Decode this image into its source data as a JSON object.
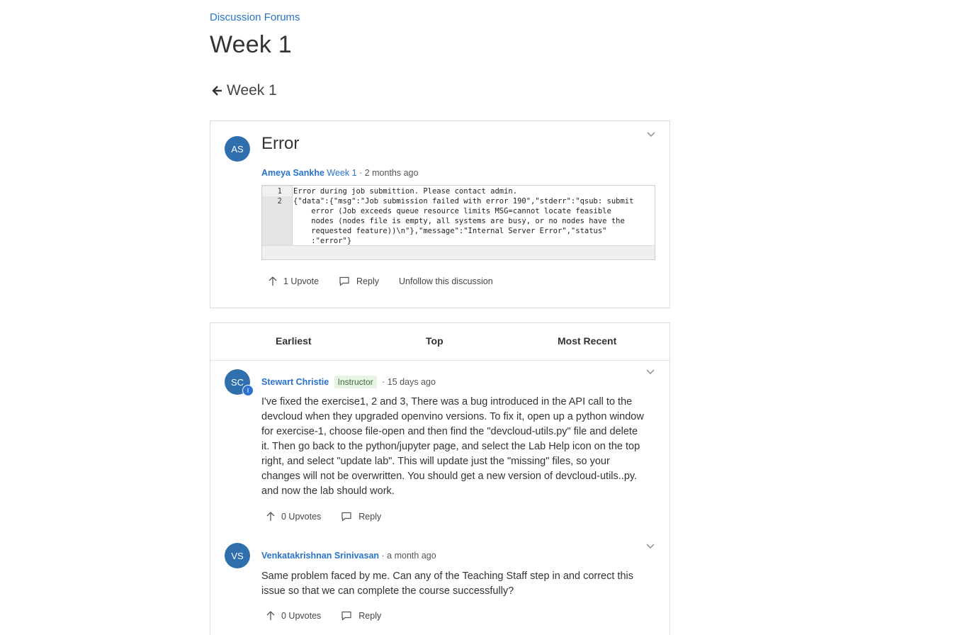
{
  "breadcrumb": "Discussion Forums",
  "page_title": "Week 1",
  "back_link": "Week 1",
  "thread": {
    "avatar_initials": "AS",
    "title": "Error",
    "author": "Ameya Sankhe",
    "topic": "Week 1",
    "time": "· 2 months ago",
    "code_line_numbers": [
      "1",
      "2"
    ],
    "code_text": "Error during job submittion. Please contact admin.\n{\"data\":{\"msg\":\"Job submission failed with error 190\",\"stderr\":\"qsub: submit\n    error (Job exceeds queue resource limits MSG=cannot locate feasible\n    nodes (nodes file is empty, all systems are busy, or no nodes have the\n    requested feature))\\n\"},\"message\":\"Internal Server Error\",\"status\"\n    :\"error\"}",
    "upvote_label": "1 Upvote",
    "reply_label": "Reply",
    "unfollow_label": "Unfollow this discussion"
  },
  "sort_tabs": [
    "Earliest",
    "Top",
    "Most Recent"
  ],
  "responses": [
    {
      "avatar_initials": "SC",
      "role_dot": "I",
      "author": "Stewart Christie",
      "badge": "Instructor",
      "time": "· 15 days ago",
      "body": "I've fixed the exercise1, 2 and 3, There was a bug introduced in the API call to the devcloud when they upgraded openvino versions. To fix it, open up a python window for exercise-1, choose file-open and then find the \"devcloud-utils.py\" file and delete it. Then go back to the python/jupyter page, and select the Lab Help icon on the top right, and select \"update lab\". This will update just the \"missing\" files, so your changes will not be overwritten. You should get a new version of devcloud-utils..py. and now the lab should work.",
      "upvote_label": "0 Upvotes",
      "reply_label": "Reply"
    },
    {
      "avatar_initials": "VS",
      "author": "Venkatakrishnan Srinivasan",
      "time": "· a month ago",
      "body": "Same problem faced by me. Can any of the Teaching Staff step in and correct this issue so that we can complete the course successfully?",
      "upvote_label": "0 Upvotes",
      "reply_label": "Reply"
    }
  ]
}
